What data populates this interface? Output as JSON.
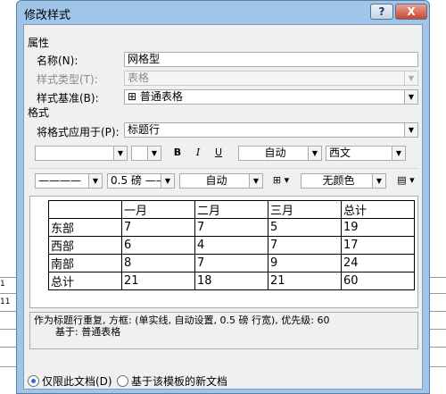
{
  "window": {
    "title": "修改样式",
    "help_label": "?",
    "close_label": "X"
  },
  "background": {
    "line_numbers": [
      "1",
      "11"
    ]
  },
  "properties": {
    "section_label": "属性",
    "name_label": "名称(N):",
    "name_value": "网格型",
    "style_type_label": "样式类型(T):",
    "style_type_value": "表格",
    "style_based_label": "样式基准(B):",
    "style_based_value": "⊞ 普通表格"
  },
  "format": {
    "section_label": "格式",
    "apply_to_label": "将格式应用于(P):",
    "apply_to_value": "标题行",
    "font_name_value": "",
    "font_size_value": "",
    "bold_label": "B",
    "italic_label": "I",
    "underline_label": "U",
    "color_value": "自动",
    "script_value": "西文",
    "line_style_value": "————",
    "line_weight_value": "0.5 磅 ——",
    "border_color_value": "自动",
    "borders_icon": "borders-icon",
    "shading_value": "无颜色",
    "more_icon": "table-format-icon"
  },
  "preview_table": {
    "headers": [
      "",
      "一月",
      "二月",
      "三月",
      "总计"
    ],
    "rows": [
      [
        "东部",
        "7",
        "7",
        "5",
        "19"
      ],
      [
        "西部",
        "6",
        "4",
        "7",
        "17"
      ],
      [
        "南部",
        "8",
        "7",
        "9",
        "24"
      ],
      [
        "总计",
        "21",
        "18",
        "21",
        "60"
      ]
    ]
  },
  "description": {
    "line1": "作为标题行重复, 方框: (单实线, 自动设置,  0.5 磅 行宽), 优先级: 60",
    "line2": "基于: 普通表格"
  },
  "options": {
    "only_this_doc_label": "仅限此文档(D)",
    "new_docs_label": "基于该模板的新文档"
  }
}
